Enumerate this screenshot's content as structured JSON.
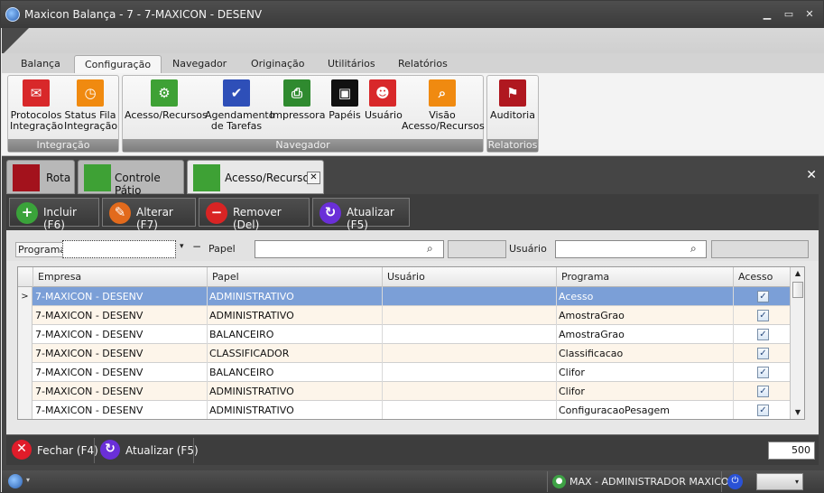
{
  "window": {
    "title": "Maxicon Balança - 7 - 7-MAXICON - DESENV",
    "controls": [
      "minimize",
      "maximize",
      "close"
    ]
  },
  "ribbon": {
    "tabs": [
      {
        "label": "Balança",
        "active": false
      },
      {
        "label": "Configuração",
        "active": true
      },
      {
        "label": "Navegador",
        "active": false
      },
      {
        "label": "Originação",
        "active": false
      },
      {
        "label": "Utilitários",
        "active": false
      },
      {
        "label": "Relatórios",
        "active": false
      }
    ],
    "groups": [
      {
        "title": "Integração",
        "buttons": [
          {
            "label": "Protocolos\nIntegração",
            "icon": "chat-protocol-icon",
            "color": "#d8282a"
          },
          {
            "label": "Status Fila\nIntegração",
            "icon": "clock-status-icon",
            "color": "#f08a10"
          }
        ]
      },
      {
        "title": "Navegador",
        "buttons": [
          {
            "label": "Acesso/Recursos",
            "icon": "users-gear-icon",
            "color": "#3ea135"
          },
          {
            "label": "Agendamento\nde Tarefas",
            "icon": "task-check-icon",
            "color": "#2e4fb8"
          },
          {
            "label": "Impressora",
            "icon": "printer-icon",
            "color": "#2f8a2f"
          },
          {
            "label": "Papéis",
            "icon": "id-card-icon",
            "color": "#111111"
          },
          {
            "label": "Usuário",
            "icon": "user-icon",
            "color": "#d8282a"
          },
          {
            "label": "Visão\nAcesso/Recursos",
            "icon": "view-access-icon",
            "color": "#f08a10"
          }
        ]
      },
      {
        "title": "Relatorios",
        "buttons": [
          {
            "label": "Auditoria",
            "icon": "audit-icon",
            "color": "#b01820"
          }
        ]
      }
    ]
  },
  "document_tabs": [
    {
      "label": "Rota",
      "icon": "signpost-icon",
      "color": "#a3121c",
      "active": false
    },
    {
      "label": "Controle Pátio",
      "icon": "chart-bars-icon",
      "color": "#3ea135",
      "active": false
    },
    {
      "label": "Acesso/Recursos",
      "icon": "users-gear-icon",
      "color": "#3ea135",
      "active": true
    }
  ],
  "toolbar": {
    "buttons": [
      {
        "label": "Incluir (F6)",
        "icon": "plus-icon",
        "glyph": "+",
        "color": "#3aa33a"
      },
      {
        "label": "Alterar (F7)",
        "icon": "pencil-icon",
        "glyph": "✎",
        "color": "#e26a1c"
      },
      {
        "label": "Remover (Del)",
        "icon": "minus-icon",
        "glyph": "−",
        "color": "#d92424"
      },
      {
        "label": "Atualizar (F5)",
        "icon": "refresh-icon",
        "glyph": "↻",
        "color": "#6a2fd8"
      }
    ]
  },
  "filters": {
    "programa_label": "Programa",
    "programa_value": "",
    "papel_label": "Papel",
    "papel_value": "",
    "usuario_label": "Usuário",
    "usuario_value": ""
  },
  "grid": {
    "columns": [
      "Empresa",
      "Papel",
      "Usuário",
      "Programa",
      "Acesso"
    ],
    "rows": [
      {
        "empresa": "7-MAXICON - DESENV",
        "papel": "ADMINISTRATIVO",
        "usuario": "",
        "programa": "Acesso",
        "acesso": true
      },
      {
        "empresa": "7-MAXICON - DESENV",
        "papel": "ADMINISTRATIVO",
        "usuario": "",
        "programa": "AmostraGrao",
        "acesso": true
      },
      {
        "empresa": "7-MAXICON - DESENV",
        "papel": "BALANCEIRO",
        "usuario": "",
        "programa": "AmostraGrao",
        "acesso": true
      },
      {
        "empresa": "7-MAXICON - DESENV",
        "papel": "CLASSIFICADOR",
        "usuario": "",
        "programa": "Classificacao",
        "acesso": true
      },
      {
        "empresa": "7-MAXICON - DESENV",
        "papel": "BALANCEIRO",
        "usuario": "",
        "programa": "Clifor",
        "acesso": true
      },
      {
        "empresa": "7-MAXICON - DESENV",
        "papel": "ADMINISTRATIVO",
        "usuario": "",
        "programa": "Clifor",
        "acesso": true
      },
      {
        "empresa": "7-MAXICON - DESENV",
        "papel": "ADMINISTRATIVO",
        "usuario": "",
        "programa": "ConfiguracaoPesagem",
        "acesso": true
      }
    ],
    "selected_row": 0
  },
  "bottom": {
    "close_label": "Fechar (F4)",
    "refresh_label": "Atualizar (F5)",
    "page_size": "500"
  },
  "status": {
    "user": "MAX - ADMINISTRADOR MAXICON"
  }
}
